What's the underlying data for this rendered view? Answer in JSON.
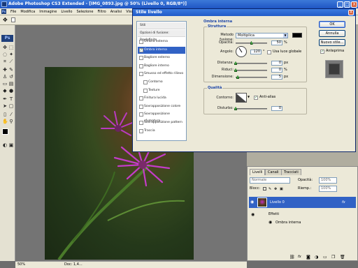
{
  "window": {
    "title": "Adobe Photoshop CS3 Extended - [IMG_0893.jpg @ 50% (Livello 0, RGB/8*)]",
    "buttons": {
      "minimize": "_",
      "maximize": "□",
      "close": "X"
    }
  },
  "menubar": {
    "items": [
      "File",
      "Modifica",
      "Immagine",
      "Livello",
      "Selezione",
      "Filtro",
      "Analisi",
      "Visualizza"
    ]
  },
  "toolbox": {
    "logo": "Ps"
  },
  "status": {
    "zoom": "50%",
    "doc_info": "Doc: 1,4..."
  },
  "layers_panel": {
    "tabs": [
      "Livelli",
      "Canali",
      "Tracciati"
    ],
    "blend_mode": "Normale",
    "opacity_label": "Opacità:",
    "opacity_value": "100%",
    "lock_label": "Blocc:",
    "fill_label": "Riemp.:",
    "fill_value": "100%",
    "layer": {
      "name": "Livello 0",
      "fx": "fx"
    },
    "effects_label": "Effetti",
    "effect_item": "Ombra interna"
  },
  "dialog": {
    "title": "Stile livello",
    "close": "X",
    "list": {
      "stili": "Stili",
      "blend_options": "Opzioni di fusione: Predefinite",
      "items": [
        {
          "label": "Ombra esterna",
          "checked": false,
          "selected": false
        },
        {
          "label": "Ombra interna",
          "checked": true,
          "selected": true
        },
        {
          "label": "Bagliore esterno",
          "checked": false,
          "selected": false
        },
        {
          "label": "Bagliore interno",
          "checked": false,
          "selected": false
        },
        {
          "label": "Smusso ed effetto rilievo",
          "checked": false,
          "selected": false
        },
        {
          "label": "Contorno",
          "checked": false,
          "selected": false,
          "sub": true
        },
        {
          "label": "Texture",
          "checked": false,
          "selected": false,
          "sub": true
        },
        {
          "label": "Finitura lucida",
          "checked": false,
          "selected": false
        },
        {
          "label": "Sovrapposizione colore",
          "checked": false,
          "selected": false
        },
        {
          "label": "Sovrapposizione sfumatura",
          "checked": false,
          "selected": false
        },
        {
          "label": "Sovrapposizione pattern",
          "checked": false,
          "selected": false
        },
        {
          "label": "Traccia",
          "checked": false,
          "selected": false
        }
      ]
    },
    "section_title": "Ombra interna",
    "structure": {
      "title": "Struttura",
      "blend_label": "Metodo fusione:",
      "blend_value": "Moltiplica",
      "color": "#000000",
      "opacity_label": "Opacità:",
      "opacity_value": "50",
      "opacity_fraction": 0.5,
      "angle_label": "Angolo:",
      "angle_value": "120",
      "global_light_label": "Usa luce globale",
      "global_light_checked": false,
      "distance_label": "Distanza:",
      "distance_value": "0",
      "choke_label": "Riduci:",
      "choke_value": "0",
      "size_label": "Dimensione:",
      "size_value": "5",
      "unit_percent": "%",
      "unit_px": "px",
      "unit_deg": "°"
    },
    "quality": {
      "title": "Qualità",
      "contour_label": "Contorno:",
      "antialias_label": "Anti-alias",
      "antialias_checked": true,
      "noise_label": "Disturbo:",
      "noise_value": "0"
    },
    "buttons": {
      "ok": "OK",
      "cancel": "Annulla",
      "new_style": "Nuovo stile...",
      "preview_label": "Anteprima",
      "preview_checked": true
    }
  }
}
